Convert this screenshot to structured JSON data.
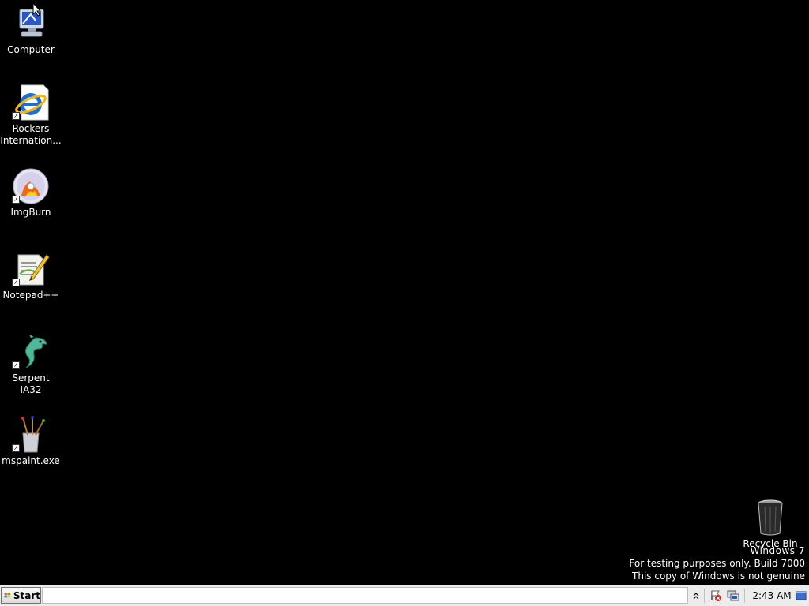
{
  "desktop": {
    "icons": [
      {
        "label": "Computer"
      },
      {
        "label": "Rockers Internation..."
      },
      {
        "label": "ImgBurn"
      },
      {
        "label": "Notepad++"
      },
      {
        "label": "Serpent IA32"
      },
      {
        "label": "mspaint.exe"
      }
    ],
    "recycle_bin": {
      "label": "Recycle Bin"
    }
  },
  "watermark": {
    "line1": "Windows 7",
    "line2": "For testing purposes only. Build 7000",
    "line3": "This copy of Windows is not genuine"
  },
  "taskbar": {
    "start_label": "Start",
    "clock": "2:43 AM"
  }
}
